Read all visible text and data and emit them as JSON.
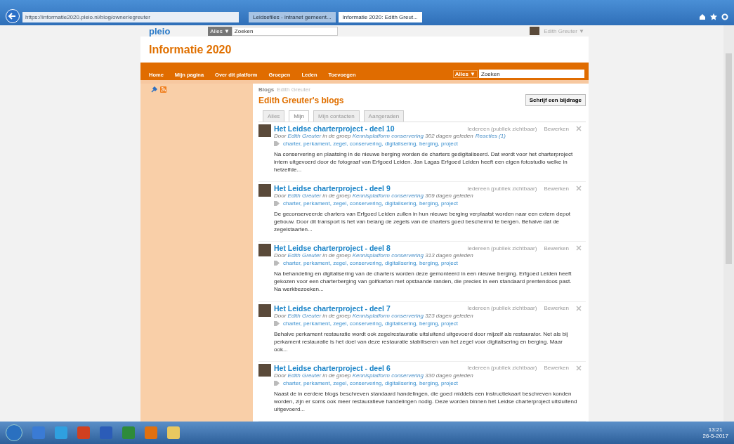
{
  "browser": {
    "url": "https://informatie2020.pleio.nl/blog/owner/egreuter",
    "tabs": [
      {
        "label": "Leidsefiles - intranet gemeent...",
        "selected": false
      },
      {
        "label": "Informatie 2020: Edith Greut...",
        "selected": true
      }
    ]
  },
  "topbar": {
    "logo": "pleio",
    "scope": "Alles ▼",
    "search_placeholder": "Zoeken",
    "user": "Edith Greuter ▼"
  },
  "site_title": "Informatie 2020",
  "nav": {
    "items": [
      "Home",
      "Mijn pagina",
      "Over dit platform",
      "Groepen",
      "Leden",
      "Toevoegen"
    ],
    "scope": "Alles ▼",
    "search_placeholder": "Zoeken"
  },
  "breadcrumb": [
    "Blogs",
    "Edith Greuter"
  ],
  "page_title": "Edith Greuter's blogs",
  "write_button": "Schrijf een bijdrage",
  "filter_tabs": [
    {
      "label": "Alles",
      "selected": false
    },
    {
      "label": "Mijn",
      "selected": true
    },
    {
      "label": "Mijn contacten",
      "selected": false
    },
    {
      "label": "Aangeraden",
      "selected": false
    }
  ],
  "posts": [
    {
      "title": "Het Leidse charterproject - deel 10",
      "by": "Door",
      "author": "Edith Greuter",
      "in_group": "in de groep",
      "group": "Kennisplatform conservering",
      "age": "302 dagen geleden",
      "comments": "Reacties (1)",
      "tags": "charter, perkament, zegel, conservering, digitalisering, berging, project",
      "access": "Iedereen (publiek zichtbaar)",
      "edit": "Bewerken",
      "excerpt": "Na conservering en plaatsing in de nieuwe berging worden de charters gedigitaliseerd. Dat wordt voor het charterproject intern uitgevoerd door de fotograaf van Erfgoed Leiden. Jan Lagas Erfgoed Leiden heeft een eigen fotostudio welke in hetzelfde..."
    },
    {
      "title": "Het Leidse charterproject - deel 9",
      "by": "Door",
      "author": "Edith Greuter",
      "in_group": "in de groep",
      "group": "Kennisplatform conservering",
      "age": "309 dagen geleden",
      "tags": "charter, perkament, zegel, conservering, digitalisering, berging, project",
      "access": "Iedereen (publiek zichtbaar)",
      "edit": "Bewerken",
      "excerpt": "De geconserveerde charters van Erfgoed Leiden zullen in hun nieuwe berging verplaatst worden naar een extern depot gebouw. Door dit transport is het van belang de zegels van de charters goed beschermd te bergen. Behalve dat de zegelstaarten..."
    },
    {
      "title": "Het Leidse charterproject - deel 8",
      "by": "Door",
      "author": "Edith Greuter",
      "in_group": "in de groep",
      "group": "Kennisplatform conservering",
      "age": "313 dagen geleden",
      "tags": "charter, perkament, zegel, conservering, digitalisering, berging, project",
      "access": "Iedereen (publiek zichtbaar)",
      "edit": "Bewerken",
      "excerpt": "Na behandeling en digitalisering van de charters worden deze gemonteerd in een nieuwe berging. Erfgoed Leiden heeft gekozen voor een charterberging van golfkarton met opstaande randen, die precies in een standaard prentendoos past. Na werkbezoeken..."
    },
    {
      "title": "Het Leidse charterproject - deel 7",
      "by": "Door",
      "author": "Edith Greuter",
      "in_group": "in de groep",
      "group": "Kennisplatform conservering",
      "age": "323 dagen geleden",
      "tags": "charter, perkament, zegel, conservering, digitalisering, berging, project",
      "access": "Iedereen (publiek zichtbaar)",
      "edit": "Bewerken",
      "excerpt": "Behalve perkament restauratie wordt ook zegelrestauratie uitsluitend uitgevoerd door mijzelf als restaurator. Net als bij perkament restauratie is het doel van deze restauratie stabiliseren van het zegel voor digitalisering en berging. Maar ook..."
    },
    {
      "title": "Het Leidse charterproject - deel 6",
      "by": "Door",
      "author": "Edith Greuter",
      "in_group": "in de groep",
      "group": "Kennisplatform conservering",
      "age": "330 dagen geleden",
      "tags": "charter, perkament, zegel, conservering, digitalisering, berging, project",
      "access": "Iedereen (publiek zichtbaar)",
      "edit": "Bewerken",
      "excerpt": "Naast de in eerdere blogs beschreven standaard handelingen, die goed middels een instructiekaart beschreven konden worden, zijn er soms ook meer restauratieve handelingen nodig. Deze worden binnen het Leidse charterproject uitsluitend uitgevoerd..."
    }
  ],
  "taskbar": {
    "time": "13:21",
    "date": "26-5-2017"
  }
}
